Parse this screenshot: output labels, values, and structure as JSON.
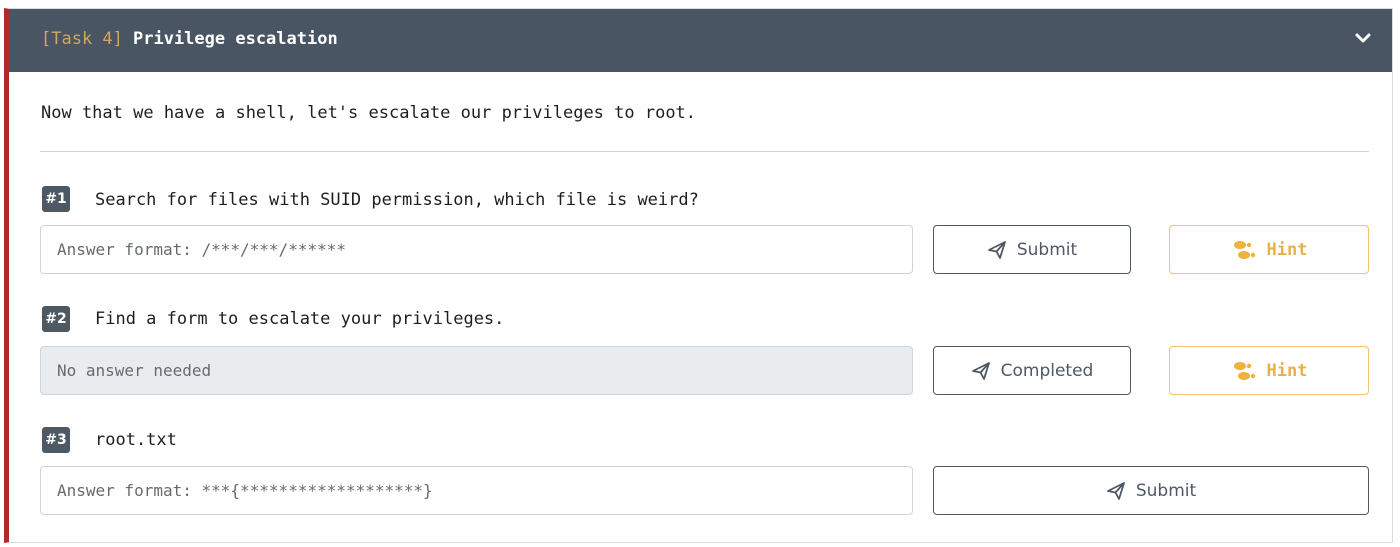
{
  "task": {
    "tag": "[Task 4]",
    "title": "Privilege escalation",
    "intro": "Now that we have a shell, let's escalate our privileges to root."
  },
  "questions": [
    {
      "number": "#1",
      "text": "Search for files with SUID permission, which file is weird?",
      "placeholder": "Answer format: /***/***/******",
      "value": "",
      "button_label": "Submit",
      "hint_label": "Hint"
    },
    {
      "number": "#2",
      "text": "Find a form to escalate your privileges.",
      "placeholder": "No answer needed",
      "value": "",
      "button_label": "Completed",
      "hint_label": "Hint"
    },
    {
      "number": "#3",
      "text": "root.txt",
      "placeholder": "Answer format: ***{*******************}",
      "value": "",
      "button_label": "Submit"
    }
  ],
  "icons": {
    "header_toggle": "chevron-down-icon",
    "submit": "paper-plane-icon",
    "hint": "footsteps-icon"
  },
  "colors": {
    "header_bg": "#4a5563",
    "task_tag": "#d1a85c",
    "accent_border": "#b02a2a",
    "badge_bg": "#4f5964",
    "hint": "#e8b04a"
  }
}
